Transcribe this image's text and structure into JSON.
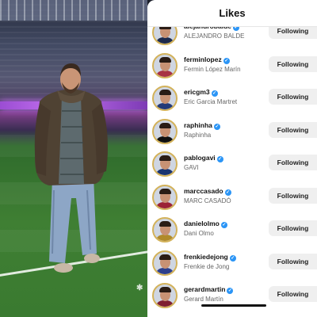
{
  "header": {
    "title": "Likes"
  },
  "follow_label": "Following",
  "likers": [
    {
      "username": "alejandrobalde",
      "full_name": "ALEJANDRO BALDE",
      "verified": true,
      "jersey": "#1d2a4c"
    },
    {
      "username": "ferminlopez",
      "full_name": "Fermin López Marín",
      "verified": true,
      "jersey": "#a83244"
    },
    {
      "username": "ericgm3",
      "full_name": "Eric Garcia Martret",
      "verified": true,
      "jersey": "#243a78"
    },
    {
      "username": "raphinha",
      "full_name": "Raphinha",
      "verified": true,
      "jersey": "#101010"
    },
    {
      "username": "pablogavi",
      "full_name": "GAVI",
      "verified": true,
      "jersey": "#1a3470"
    },
    {
      "username": "marccasado",
      "full_name": "MARC CASADÓ",
      "verified": true,
      "jersey": "#9b2336"
    },
    {
      "username": "danielolmo",
      "full_name": "Dani Olmo",
      "verified": true,
      "jersey": "#b08a2a"
    },
    {
      "username": "frenkiedejong",
      "full_name": "Frenkie de Jong",
      "verified": true,
      "jersey": "#2e3f8c"
    },
    {
      "username": "gerardmartin",
      "full_name": "Gerard Martín",
      "verified": true,
      "jersey": "#7f1f31"
    }
  ],
  "colors": {
    "verified": "#2b95f6",
    "button_bg": "#efefef",
    "story_ring": "#d3b25a"
  }
}
